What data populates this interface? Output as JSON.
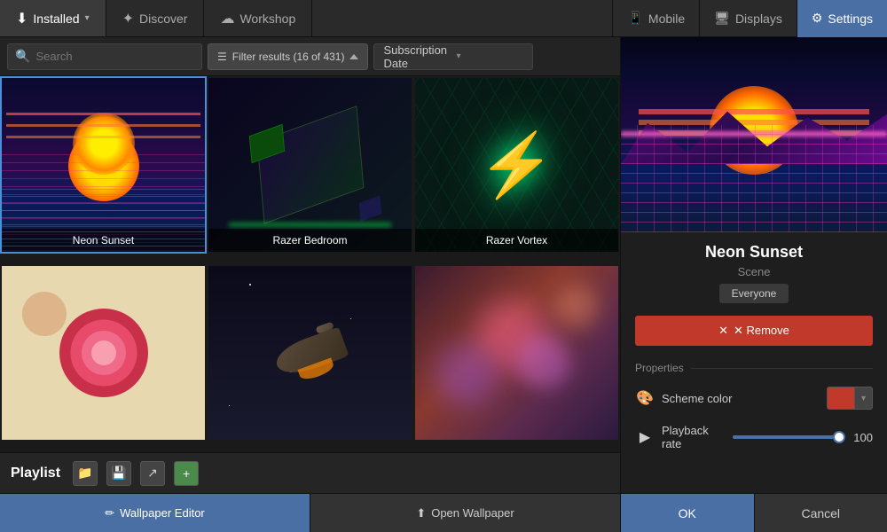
{
  "nav": {
    "installed_label": "Installed",
    "discover_label": "Discover",
    "workshop_label": "Workshop",
    "mobile_label": "Mobile",
    "displays_label": "Displays",
    "settings_label": "Settings"
  },
  "filter_bar": {
    "search_placeholder": "Search",
    "filter_label": "Filter results (16 of 431)",
    "sort_label": "Subscription Date"
  },
  "grid": {
    "items": [
      {
        "name": "Neon Sunset",
        "type": "neon-sunset",
        "selected": true
      },
      {
        "name": "Razer Bedroom",
        "type": "razer-bedroom",
        "selected": false
      },
      {
        "name": "Razer Vortex",
        "type": "razer-vortex",
        "selected": false
      },
      {
        "name": "",
        "type": "retro-abstract",
        "selected": false
      },
      {
        "name": "",
        "type": "spaceship",
        "selected": false
      },
      {
        "name": "",
        "type": "bokeh",
        "selected": false
      }
    ]
  },
  "playlist": {
    "label": "Playlist",
    "icons": [
      "folder",
      "save",
      "share",
      "add"
    ]
  },
  "bottom": {
    "wallpaper_editor": "Wallpaper Editor",
    "open_wallpaper": "Open Wallpaper"
  },
  "right_panel": {
    "wallpaper_title": "Neon Sunset",
    "wallpaper_type": "Scene",
    "audience_badge": "Everyone",
    "remove_label": "✕ Remove",
    "properties_label": "Properties",
    "scheme_color_label": "Scheme color",
    "playback_rate_label": "Playback rate",
    "playback_rate_value": "100",
    "ok_label": "OK",
    "cancel_label": "Cancel"
  }
}
